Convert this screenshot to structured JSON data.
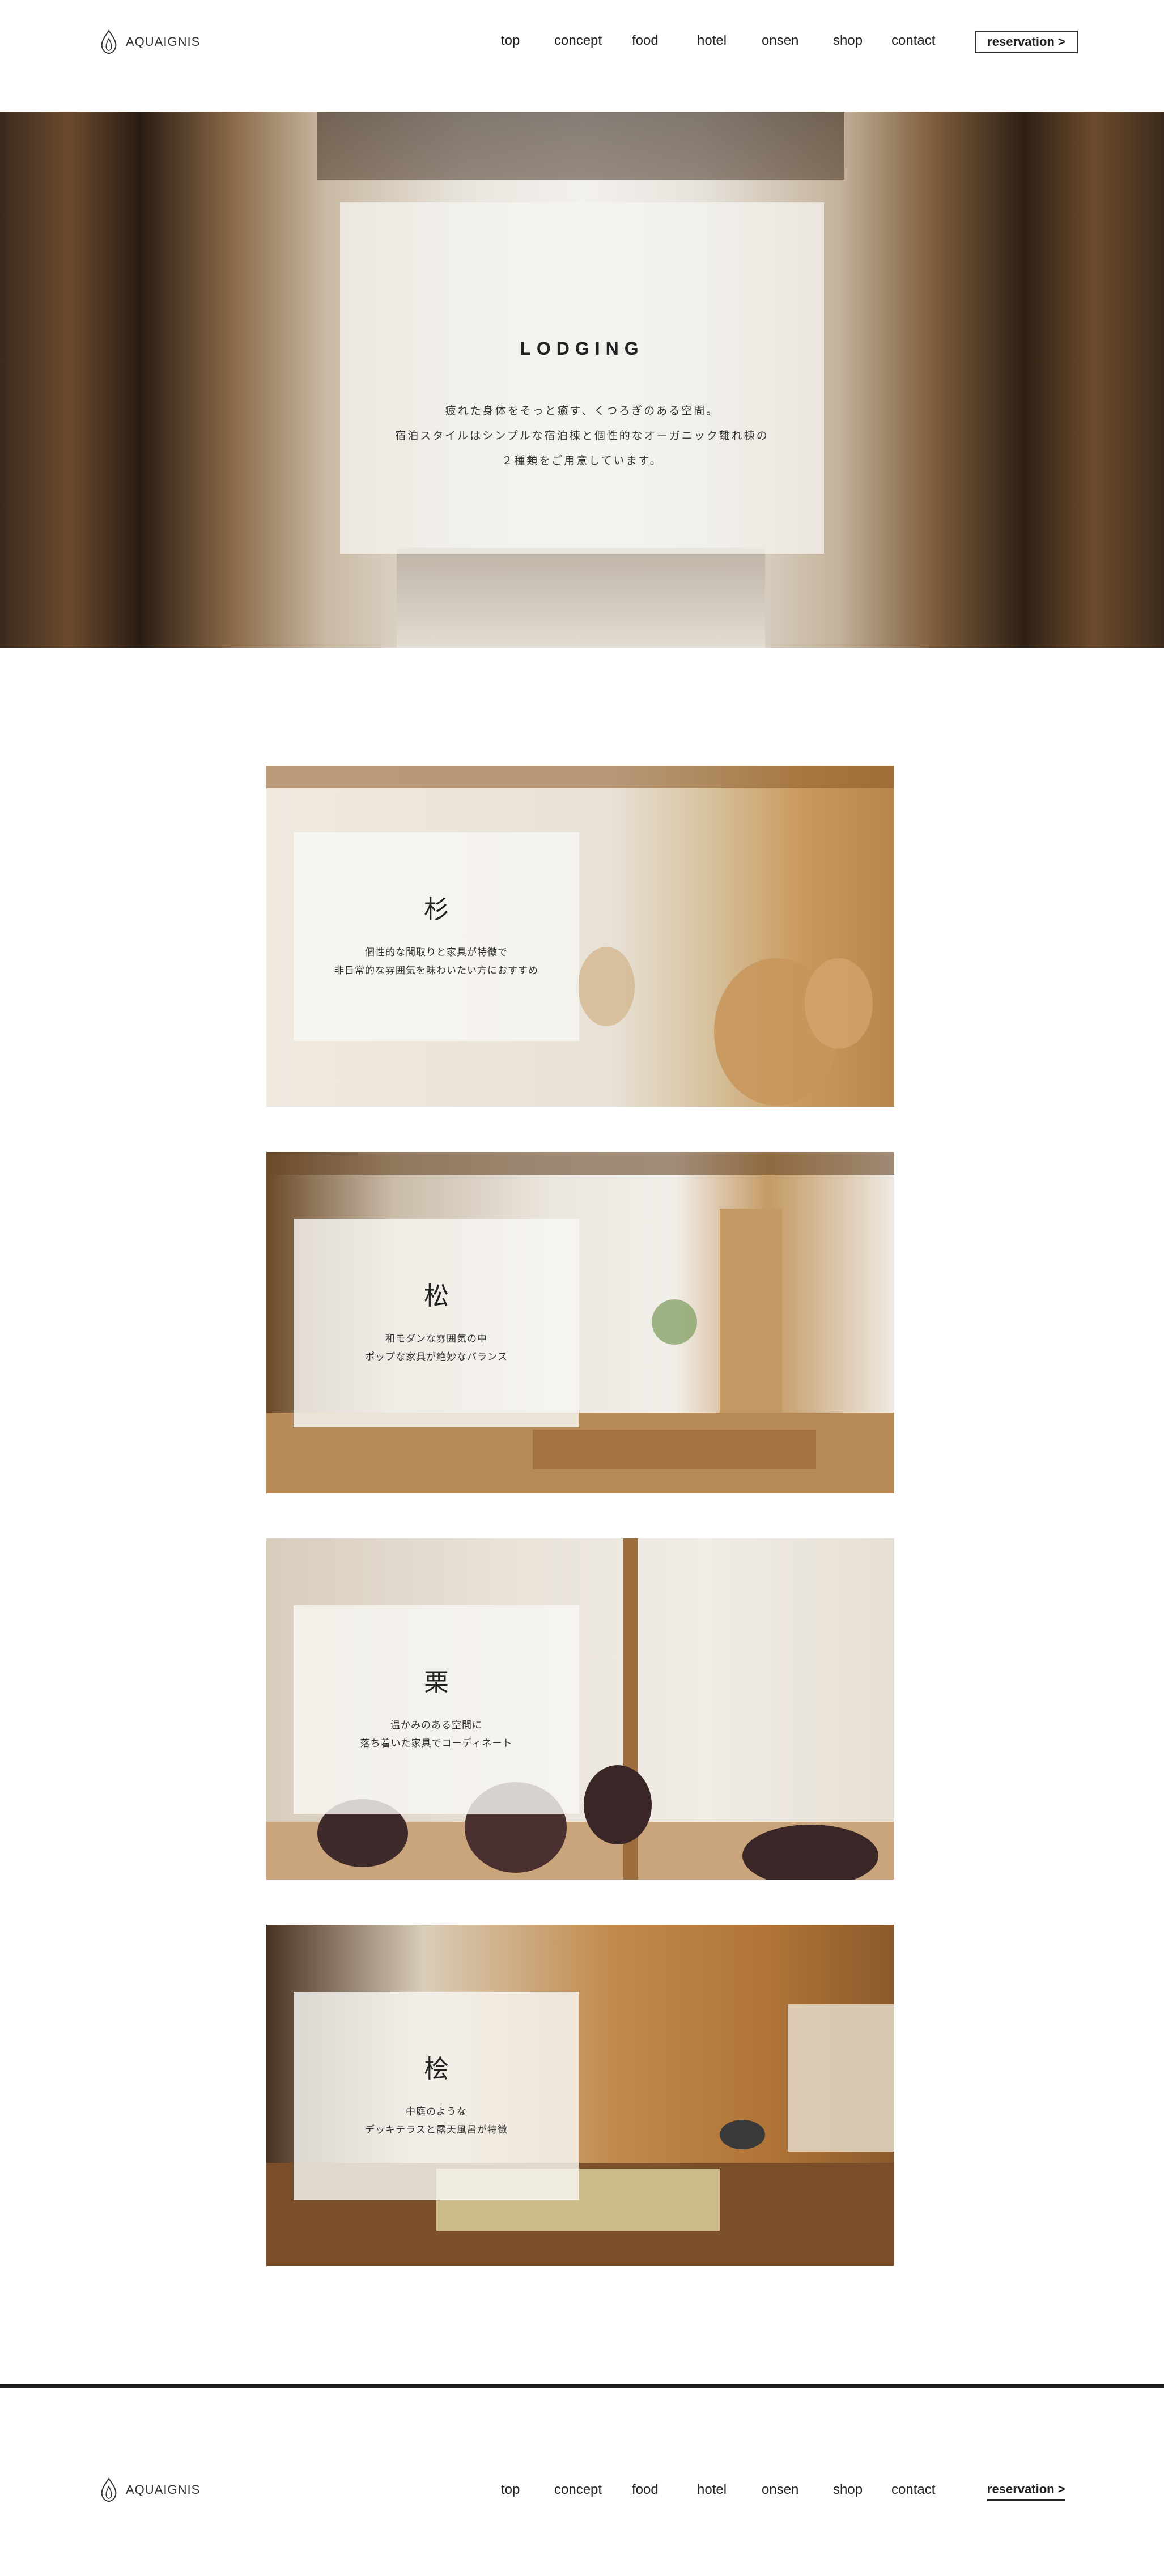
{
  "brand": {
    "name": "AQUAIGNIS"
  },
  "nav": {
    "items": [
      "top",
      "concept",
      "food",
      "hotel",
      "onsen",
      "shop",
      "contact"
    ],
    "reservation": "reservation >"
  },
  "hero": {
    "title": "LODGING",
    "lines": [
      "疲れた身体をそっと癒す、くつろぎのある空間。",
      "宿泊スタイルはシンプルな宿泊棟と個性的なオーガニック離れ棟の",
      "２種類をご用意しています。"
    ]
  },
  "rooms": [
    {
      "name": "杉",
      "lines": [
        "個性的な間取りと家具が特徴で",
        "非日常的な雰囲気を味わいたい方におすすめ"
      ]
    },
    {
      "name": "松",
      "lines": [
        "和モダンな雰囲気の中",
        "ポップな家具が絶妙なバランス"
      ]
    },
    {
      "name": "栗",
      "lines": [
        "温かみのある空間に",
        "落ち着いた家具でコーディネート"
      ]
    },
    {
      "name": "桧",
      "lines": [
        "中庭のような",
        "デッキテラスと露天風呂が特徴"
      ]
    }
  ],
  "footer": {
    "nav": [
      "top",
      "concept",
      "food",
      "hotel",
      "onsen",
      "shop",
      "contact"
    ],
    "reservation": "reservation >"
  },
  "icons": {
    "logo": "flame-drop-logo-icon"
  },
  "colors": {
    "text": "#222222",
    "footer_rule": "#1a1a1a",
    "overlay": "#f5f3f0"
  }
}
